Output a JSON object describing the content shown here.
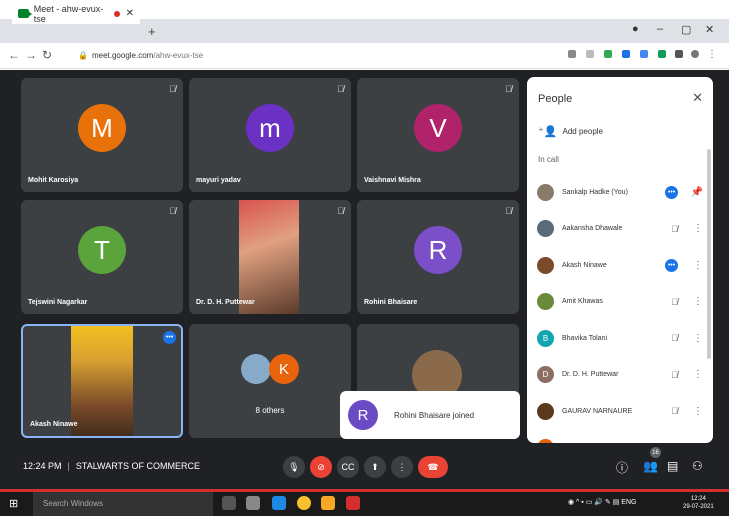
{
  "browser": {
    "tab_title": "Meet - ahw-evux-tse",
    "url_host": "meet.google.com",
    "url_path": "/ahw-evux-tse"
  },
  "tiles": [
    {
      "name": "Mohit Karosiya",
      "initial": "M",
      "color": "#e8710a"
    },
    {
      "name": "mayuri yadav",
      "initial": "m",
      "color": "#6a31c4"
    },
    {
      "name": "Vaishnavi Mishra",
      "initial": "V",
      "color": "#b0226a"
    },
    {
      "name": "Tejswini Nagarkar",
      "initial": "T",
      "color": "#5ba33b"
    },
    {
      "name": "Dr. D. H. Puttewar",
      "initial": "",
      "color": ""
    },
    {
      "name": "Rohini Bhaisare",
      "initial": "R",
      "color": "#7b4fc8"
    },
    {
      "name": "Akash Ninawe",
      "initial": "",
      "color": ""
    },
    {
      "name": "8 others",
      "initial": "K",
      "color": "#e8630a"
    }
  ],
  "toast": {
    "initial": "R",
    "text": "Rohini Bhaisare joined"
  },
  "panel": {
    "title": "People",
    "add_people": "Add people",
    "in_call": "In call",
    "people": [
      {
        "name": "Sankalp Hadke (You)",
        "initial": "",
        "color": "#8a7a6a",
        "state": "dots",
        "more": "pin"
      },
      {
        "name": "Aakansha Dhawale",
        "initial": "",
        "color": "#5a6a7a",
        "state": "muted",
        "more": "more"
      },
      {
        "name": "Akash Ninawe",
        "initial": "",
        "color": "#7a4a2a",
        "state": "dots",
        "more": "more"
      },
      {
        "name": "Amit Khawas",
        "initial": "",
        "color": "#6a8a3a",
        "state": "muted",
        "more": "more"
      },
      {
        "name": "Bhavika Tolani",
        "initial": "B",
        "color": "#12a4b0",
        "state": "muted",
        "more": "more"
      },
      {
        "name": "Dr. D. H. Puttewar",
        "initial": "D",
        "color": "#8d6e63",
        "state": "muted",
        "more": "more"
      },
      {
        "name": "GAURAV NARNAURE",
        "initial": "",
        "color": "#5a3a1a",
        "state": "muted",
        "more": "more"
      },
      {
        "name": "",
        "initial": "",
        "color": "#e8630a",
        "state": "muted",
        "more": "more"
      }
    ]
  },
  "bottom": {
    "time": "12:24 PM",
    "meeting_name": "STALWARTS OF COMMERCE",
    "participant_count": "16"
  },
  "taskbar": {
    "search_placeholder": "Search Windows",
    "lang": "ENG",
    "clock_time": "12:24",
    "clock_date": "29-07-2021"
  }
}
